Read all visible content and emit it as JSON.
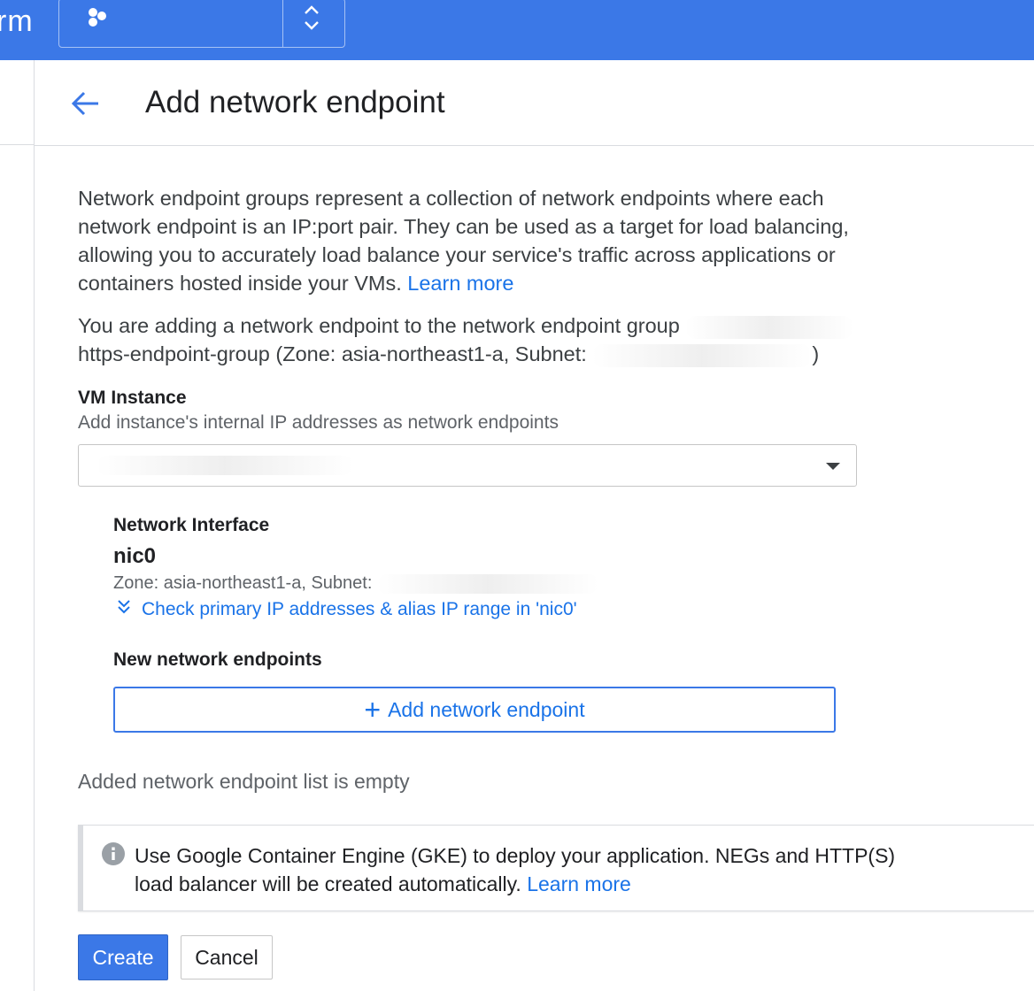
{
  "topbar": {
    "brand": "rm",
    "icons": {
      "project": "hexagon-cluster-icon",
      "switcher": "chevron-up-down-icon"
    }
  },
  "header": {
    "back_icon": "arrow-back-icon",
    "title": "Add network endpoint"
  },
  "intro": {
    "text": "Network endpoint groups represent a collection of network endpoints where each network endpoint is an IP:port pair. They can be used as a target for load balancing, allowing you to accurately load balance your service's traffic across applications or containers hosted inside your VMs.",
    "learn_more": "Learn more"
  },
  "group_info": {
    "prefix": "You are adding a network endpoint to the network endpoint group",
    "group_line": "https-endpoint-group (Zone: asia-northeast1-a, Subnet:",
    "suffix": ")"
  },
  "vm_instance": {
    "label": "VM Instance",
    "hint": "Add instance's internal IP addresses as network endpoints",
    "selected": ""
  },
  "network_interface": {
    "label": "Network Interface",
    "name": "nic0",
    "zone_line": "Zone: asia-northeast1-a, Subnet:",
    "expand_link": "Check primary IP addresses & alias IP range in 'nic0'"
  },
  "new_endpoints": {
    "label": "New network endpoints",
    "add_button": "Add network endpoint",
    "empty": "Added network endpoint list is empty"
  },
  "info": {
    "icon": "info-icon",
    "text": "Use Google Container Engine (GKE) to deploy your application. NEGs and HTTP(S) load balancer will be created automatically.",
    "learn_more": "Learn more"
  },
  "actions": {
    "create": "Create",
    "cancel": "Cancel"
  },
  "colors": {
    "topbar": "#3b78e7",
    "link": "#1a73e8",
    "primary_button": "#3b78e7"
  }
}
